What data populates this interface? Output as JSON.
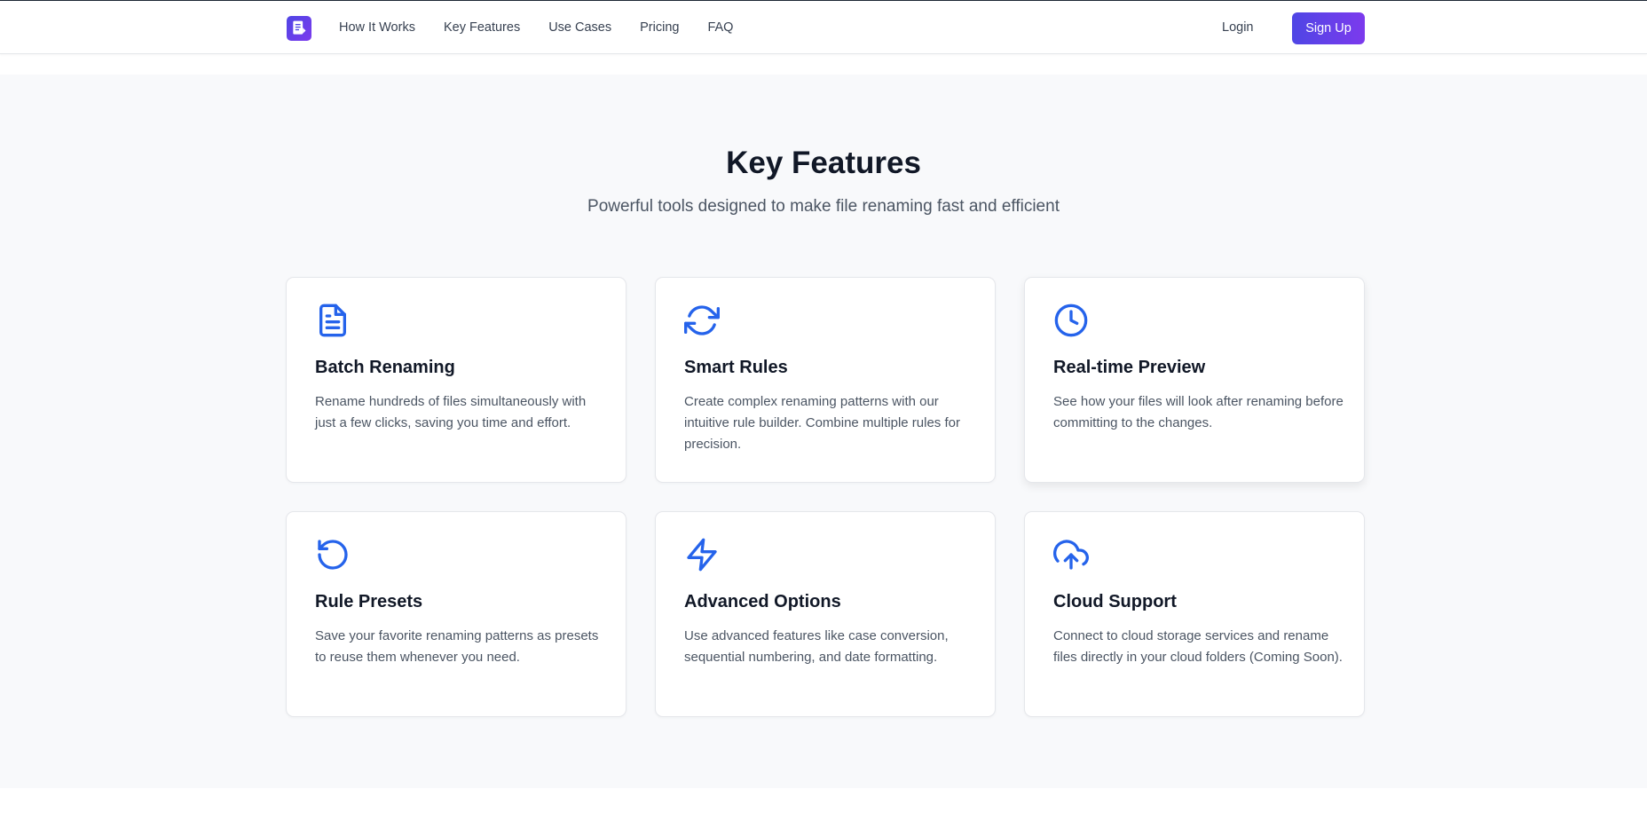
{
  "nav": {
    "links": [
      "How It Works",
      "Key Features",
      "Use Cases",
      "Pricing",
      "FAQ"
    ],
    "login_label": "Login",
    "signup_label": "Sign Up"
  },
  "features": {
    "title": "Key Features",
    "subtitle": "Powerful tools designed to make file renaming fast and efficient",
    "cards": [
      {
        "icon": "document-icon",
        "title": "Batch Renaming",
        "description": "Rename hundreds of files simultaneously with just a few clicks, saving you time and effort."
      },
      {
        "icon": "refresh-icon",
        "title": "Smart Rules",
        "description": "Create complex renaming patterns with our intuitive rule builder. Combine multiple rules for precision."
      },
      {
        "icon": "clock-icon",
        "title": "Real-time Preview",
        "description": "See how your files will look after renaming before committing to the changes."
      },
      {
        "icon": "undo-icon",
        "title": "Rule Presets",
        "description": "Save your favorite renaming patterns as presets to reuse them whenever you need."
      },
      {
        "icon": "lightning-icon",
        "title": "Advanced Options",
        "description": "Use advanced features like case conversion, sequential numbering, and date formatting."
      },
      {
        "icon": "cloud-upload-icon",
        "title": "Cloud Support",
        "description": "Connect to cloud storage services and rename files directly in your cloud folders (Coming Soon)."
      }
    ]
  },
  "colors": {
    "accent": "#4f46e5",
    "accent_end": "#7c3aed",
    "icon": "#2563eb",
    "section_bg": "#f8f9fb"
  }
}
